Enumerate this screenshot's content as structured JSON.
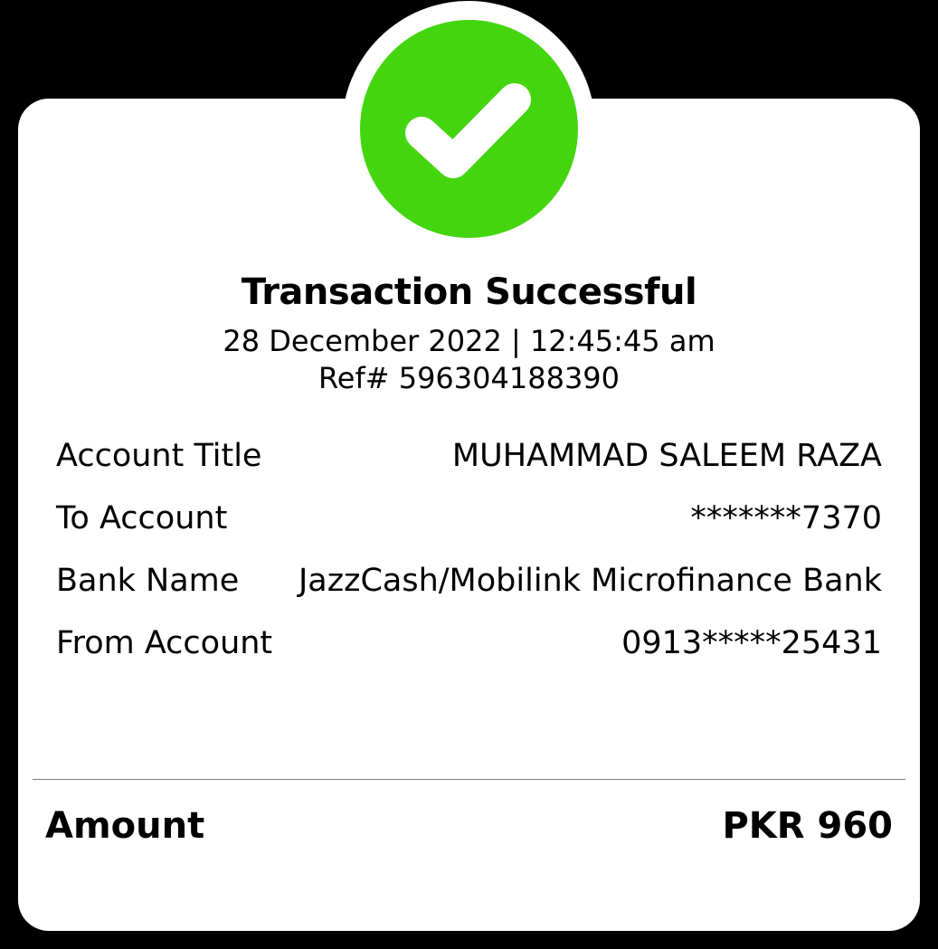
{
  "status": {
    "icon": "check-circle-icon",
    "color": "#43d60f",
    "title": "Transaction Successful",
    "datetime": "28 December 2022 | 12:45:45 am",
    "reference": "Ref# 596304188390"
  },
  "details": [
    {
      "label": "Account Title",
      "value": "MUHAMMAD SALEEM RAZA"
    },
    {
      "label": "To Account",
      "value": "*******7370"
    },
    {
      "label": "Bank Name",
      "value": "JazzCash/Mobilink Microfinance Bank"
    },
    {
      "label": "From Account",
      "value": "0913*****25431"
    }
  ],
  "amount": {
    "label": "Amount",
    "value": "PKR 960"
  }
}
